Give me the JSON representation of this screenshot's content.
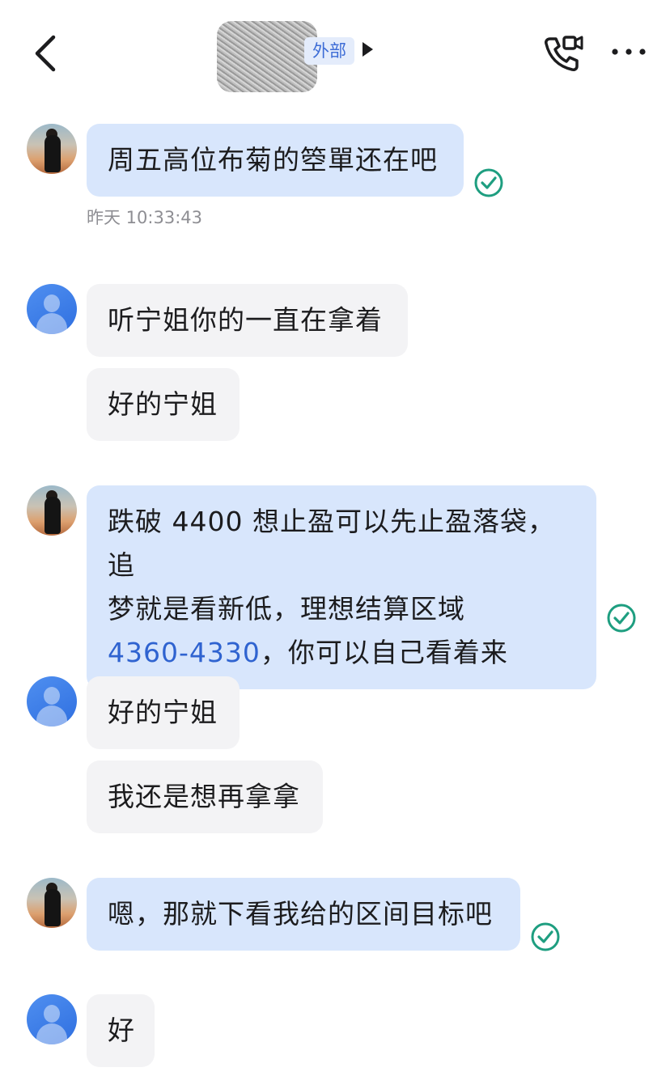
{
  "header": {
    "tag": "外部",
    "icons": {
      "back": "chevron-left-icon",
      "title_arrow": "triangle-right-icon",
      "call": "phone-video-call-icon",
      "more": "more-dots-icon"
    }
  },
  "colors": {
    "mine_bubble": "#d8e6fc",
    "their_bubble": "#f3f3f5",
    "accent": "#2f63d0",
    "check": "#1e9e80"
  },
  "messages": [
    {
      "sender": "self",
      "text": "周五高位布菊的箜單还在吧",
      "read": true,
      "timestamp": "昨天 10:33:43"
    },
    {
      "sender": "other",
      "text": "听宁姐你的一直在拿着"
    },
    {
      "sender": "other",
      "text": "好的宁姐"
    },
    {
      "sender": "self",
      "line1": "跌破 4400 想止盈可以先止盈落袋，追",
      "line2": "梦就是看新低，理想结算区域",
      "link": "4360-4330",
      "line3_rest": "，你可以自己看着来",
      "read": true
    },
    {
      "sender": "other",
      "text": "好的宁姐"
    },
    {
      "sender": "other",
      "text": "我还是想再拿拿"
    },
    {
      "sender": "self",
      "text": "嗯，那就下看我给的区间目标吧",
      "read": true
    },
    {
      "sender": "other",
      "text": "好"
    }
  ]
}
